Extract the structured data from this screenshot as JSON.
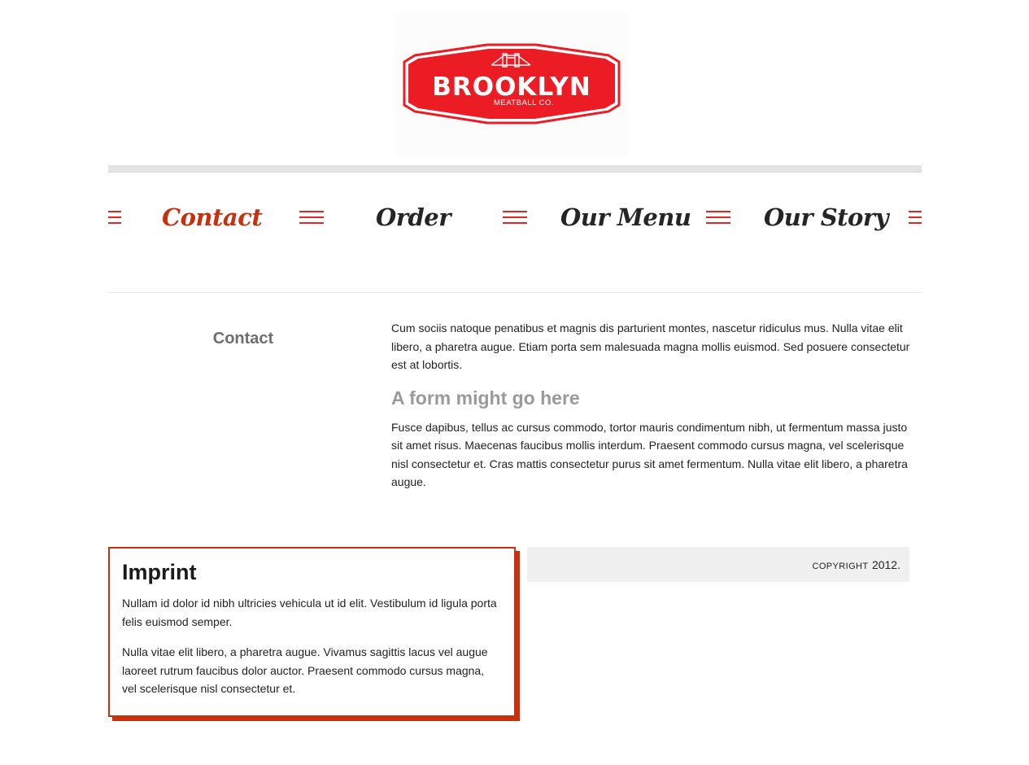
{
  "header": {
    "logo": {
      "wordmark": "BROOKLYN",
      "subtitle": "MEATBALL CO.",
      "brand_color": "#ec1c24"
    }
  },
  "nav": {
    "items": [
      {
        "label": "Contact",
        "active": true
      },
      {
        "label": "Order",
        "active": false
      },
      {
        "label": "Our Menu",
        "active": false
      },
      {
        "label": "Our Story",
        "active": false
      }
    ],
    "separator_icon": "hamburger-bars-icon",
    "accent_color": "#e42522",
    "active_color": "#c8300e"
  },
  "page": {
    "title": "Contact",
    "intro": "Cum sociis natoque penatibus et magnis dis parturient montes, nascetur ridiculus mus. Nulla vitae elit libero, a pharetra augue. Etiam porta sem malesuada magna mollis euismod. Sed posuere consectetur est at lobortis.",
    "form_heading": "A form might go here",
    "body": "Fusce dapibus, tellus ac cursus commodo, tortor mauris condimentum nibh, ut fermentum massa justo sit amet risus. Maecenas faucibus mollis interdum. Praesent commodo cursus magna, vel scelerisque nisl consectetur et. Cras mattis consectetur purus sit amet fermentum. Nulla vitae elit libero, a pharetra augue."
  },
  "imprint": {
    "title": "Imprint",
    "paragraphs": [
      "Nullam id dolor id nibh ultricies vehicula ut id elit. Vestibulum id ligula porta felis euismod semper.",
      "Nulla vitae elit libero, a pharetra augue. Vivamus sagittis lacus vel augue laoreet rutrum faucibus dolor auctor. Praesent commodo cursus magna, vel scelerisque nisl consectetur et."
    ],
    "border_color": "#c8300e"
  },
  "footer": {
    "copyright_label": "COPYRIGHT",
    "copyright_year": "2012."
  }
}
